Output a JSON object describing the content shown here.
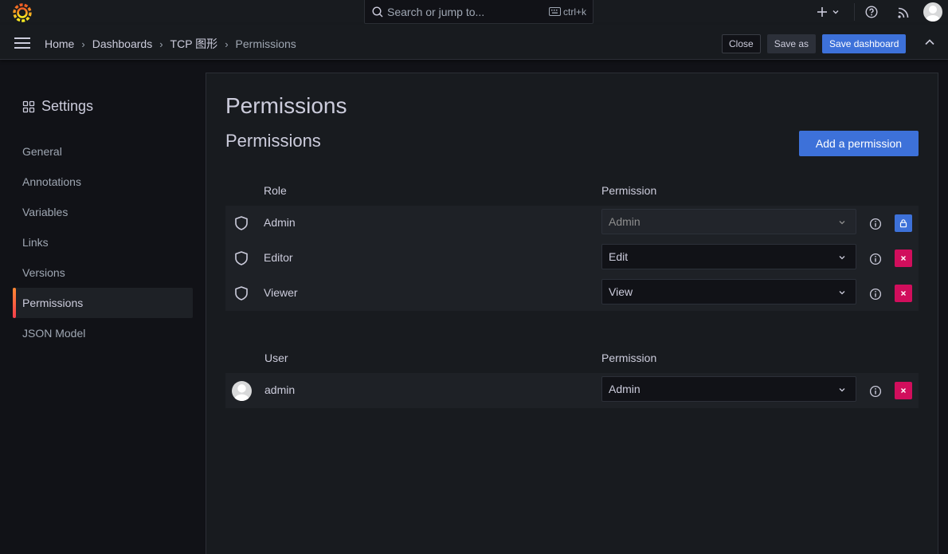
{
  "topbar": {
    "search_placeholder": "Search or jump to...",
    "shortcut": "ctrl+k",
    "icons": [
      "grafana-logo-icon",
      "search-icon",
      "keyboard-icon",
      "plus-icon",
      "chevron-down-icon",
      "help-icon",
      "rss-icon",
      "user-avatar-icon"
    ]
  },
  "navbar": {
    "breadcrumbs": [
      {
        "label": "Home"
      },
      {
        "label": "Dashboards"
      },
      {
        "label": "TCP 图形"
      },
      {
        "label": "Permissions"
      }
    ],
    "separator": "›",
    "close_label": "Close",
    "save_as_label": "Save as",
    "save_dashboard_label": "Save dashboard"
  },
  "sidebar": {
    "title": "Settings",
    "items": [
      {
        "label": "General",
        "active": false
      },
      {
        "label": "Annotations",
        "active": false
      },
      {
        "label": "Variables",
        "active": false
      },
      {
        "label": "Links",
        "active": false
      },
      {
        "label": "Versions",
        "active": false
      },
      {
        "label": "Permissions",
        "active": true
      },
      {
        "label": "JSON Model",
        "active": false
      }
    ]
  },
  "main": {
    "page_title": "Permissions",
    "section_title": "Permissions",
    "add_button_label": "Add a permission",
    "roles_table": {
      "headers": {
        "role": "Role",
        "permission": "Permission"
      },
      "rows": [
        {
          "name": "Admin",
          "permission": "Admin",
          "disabled": true,
          "action": "lock"
        },
        {
          "name": "Editor",
          "permission": "Edit",
          "disabled": false,
          "action": "remove"
        },
        {
          "name": "Viewer",
          "permission": "View",
          "disabled": false,
          "action": "remove"
        }
      ]
    },
    "users_table": {
      "headers": {
        "user": "User",
        "permission": "Permission"
      },
      "rows": [
        {
          "name": "admin",
          "permission": "Admin",
          "disabled": false,
          "action": "remove"
        }
      ]
    }
  },
  "colors": {
    "primary": "#3d71d9",
    "destructive": "#d10e5c",
    "accent": "#f55f3e",
    "background": "#111217",
    "panel": "#181b1f"
  }
}
